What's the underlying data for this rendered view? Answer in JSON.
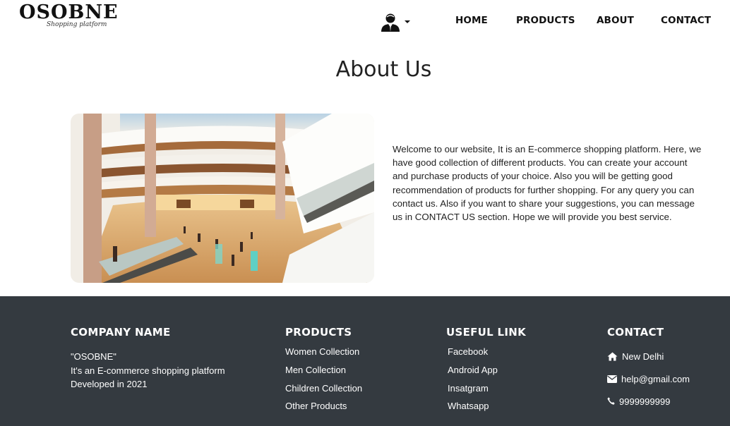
{
  "brand": {
    "name": "OSOBNE",
    "tagline": "Shopping platform"
  },
  "nav": {
    "user_icon": "user-icon",
    "links": [
      "HOME",
      "PRODUCTS",
      "ABOUT",
      "CONTACT"
    ]
  },
  "about": {
    "title": "About Us",
    "image_alt": "Shopping mall interior",
    "text": "Welcome to our website, It is an E-commerce shopping platform. Here, we have good collection of different products. You can create your account and purchase products of your choice. Also you will be getting good recommendation of products for further shopping. For any query you can contact us. Also if you want to share your suggestions, you can message us in CONTACT US section. Hope we will provide you best service."
  },
  "footer": {
    "company": {
      "heading": "COMPANY NAME",
      "lines": [
        "\"OSOBNE\"",
        "It's an E-commerce shopping platform",
        "Developed in 2021"
      ]
    },
    "products": {
      "heading": "PRODUCTS",
      "links": [
        "Women Collection",
        "Men Collection",
        "Children Collection",
        "Other Products"
      ]
    },
    "useful": {
      "heading": "USEFUL LINK",
      "links": [
        "Facebook",
        "Android App",
        "Insatgram",
        "Whatsapp"
      ]
    },
    "contact": {
      "heading": "CONTACT",
      "address": "New Delhi",
      "email": "help@gmail.com",
      "phone": "9999999999",
      "icons": [
        "home-icon",
        "envelope-icon",
        "phone-icon"
      ]
    }
  },
  "colors": {
    "footer_bg": "#343a40",
    "text": "#212529"
  }
}
